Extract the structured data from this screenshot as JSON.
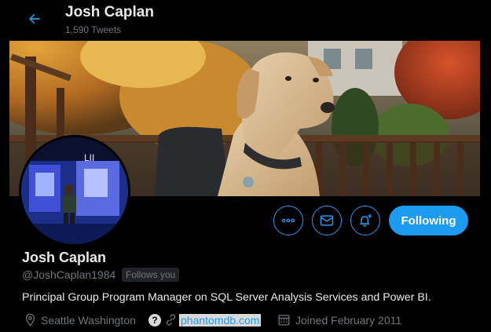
{
  "header": {
    "name": "Josh Caplan",
    "tweet_count": "1,590 Tweets"
  },
  "profile": {
    "name": "Josh Caplan",
    "handle": "@JoshCaplan1984",
    "follows_you": "Follows you",
    "bio": "Principal Group Program Manager on SQL Server Analysis Services and Power BI.",
    "location": "Seattle Washington",
    "website": "phantomdb.com",
    "joined": "Joined February 2011"
  },
  "actions": {
    "follow_label": "Following"
  },
  "colors": {
    "accent": "#1d9bf0",
    "background": "#000000",
    "secondary_text": "#71767b"
  },
  "icons": {
    "back": "arrow-left-icon",
    "more": "more-horizontal-icon",
    "message": "envelope-icon",
    "notify": "bell-plus-icon",
    "location": "map-pin-icon",
    "link": "link-icon",
    "calendar": "calendar-icon"
  }
}
